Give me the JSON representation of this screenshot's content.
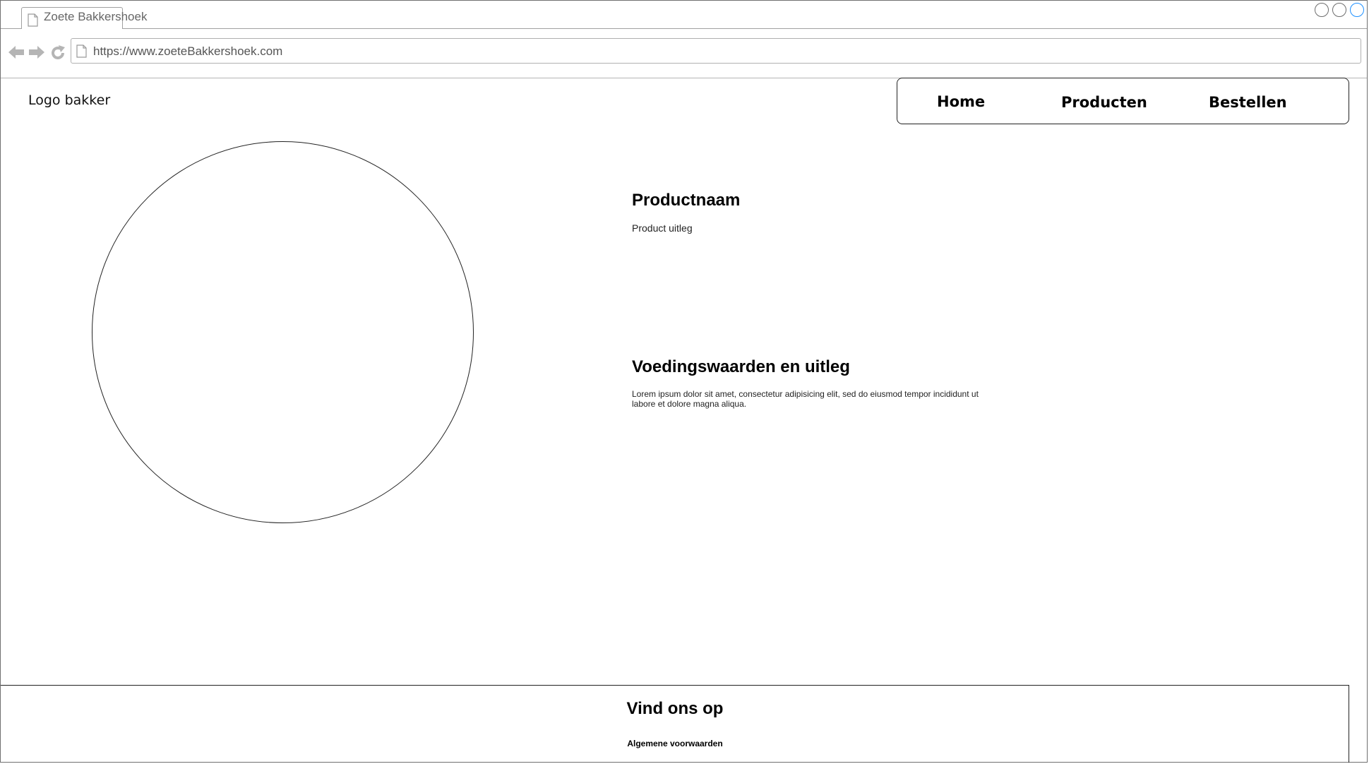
{
  "browser": {
    "tab_title": "Zoete Bakkershoek",
    "url": "https://www.zoeteBakkershoek.com",
    "accent_color": "#1e90ff"
  },
  "header": {
    "logo_text": "Logo bakker",
    "nav": [
      {
        "label": "Home"
      },
      {
        "label": "Producten"
      },
      {
        "label": "Bestellen"
      }
    ]
  },
  "product": {
    "name": "Productnaam",
    "description": "Product uitleg",
    "nutrition_heading": "Voedingswaarden en uitleg",
    "nutrition_text": "Lorem ipsum dolor sit amet, consectetur adipisicing elit, sed do eiusmod tempor incididunt ut labore et dolore magna aliqua."
  },
  "footer": {
    "heading": "Vind ons op",
    "terms_link": "Algemene voorwaarden"
  }
}
